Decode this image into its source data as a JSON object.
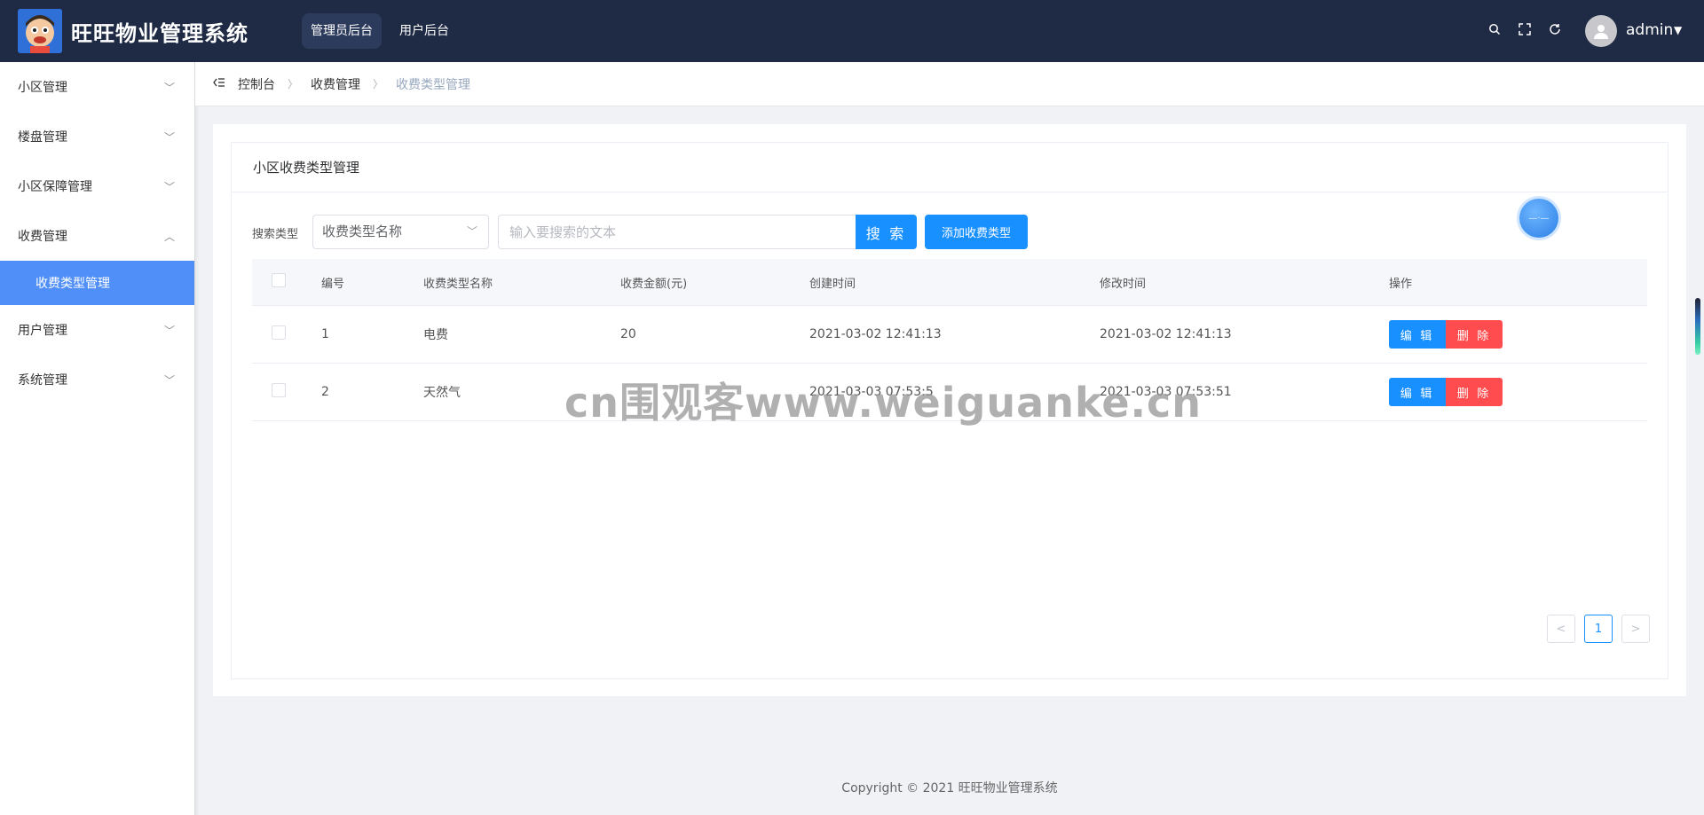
{
  "header": {
    "brand": "旺旺物业管理系统",
    "tabs": [
      {
        "label": "管理员后台",
        "active": true
      },
      {
        "label": "用户后台",
        "active": false
      }
    ],
    "icons": [
      "search-icon",
      "fullscreen-icon",
      "refresh-icon"
    ],
    "username": "admin",
    "bg_color": "#1f2a44"
  },
  "sidebar": {
    "items": [
      {
        "label": "小区管理",
        "expanded": false
      },
      {
        "label": "楼盘管理",
        "expanded": false
      },
      {
        "label": "小区保障管理",
        "expanded": false
      },
      {
        "label": "收费管理",
        "expanded": true
      },
      {
        "label": "用户管理",
        "expanded": false
      },
      {
        "label": "系统管理",
        "expanded": false
      }
    ],
    "active_subitem": "收费类型管理",
    "active_color": "#4f8ff7"
  },
  "breadcrumb": [
    "控制台",
    "收费管理",
    "收费类型管理"
  ],
  "card": {
    "title": "小区收费类型管理"
  },
  "search": {
    "label": "搜索类型",
    "select_value": "收费类型名称",
    "placeholder": "输入要搜索的文本",
    "search_button": "搜 索",
    "add_button": "添加收费类型"
  },
  "table": {
    "headers": [
      "编号",
      "收费类型名称",
      "收费金额(元)",
      "创建时间",
      "修改时间",
      "操作"
    ],
    "rows": [
      {
        "id": "1",
        "name": "电费",
        "amount": "20",
        "created": "2021-03-02 12:41:13",
        "modified": "2021-03-02 12:41:13"
      },
      {
        "id": "2",
        "name": "天然气",
        "amount": "",
        "created": "2021-03-03 07:53:5",
        "modified": "2021-03-03 07:53:51"
      }
    ],
    "edit_label": "编 辑",
    "delete_label": "删 除"
  },
  "pagination": {
    "prev": "<",
    "current": "1",
    "next": ">"
  },
  "watermark": "cn围观客www.weiguanke.cn",
  "footer": "Copyright © 2021 旺旺物业管理系统",
  "colors": {
    "primary": "#1890ff",
    "danger": "#ff4d4f"
  }
}
